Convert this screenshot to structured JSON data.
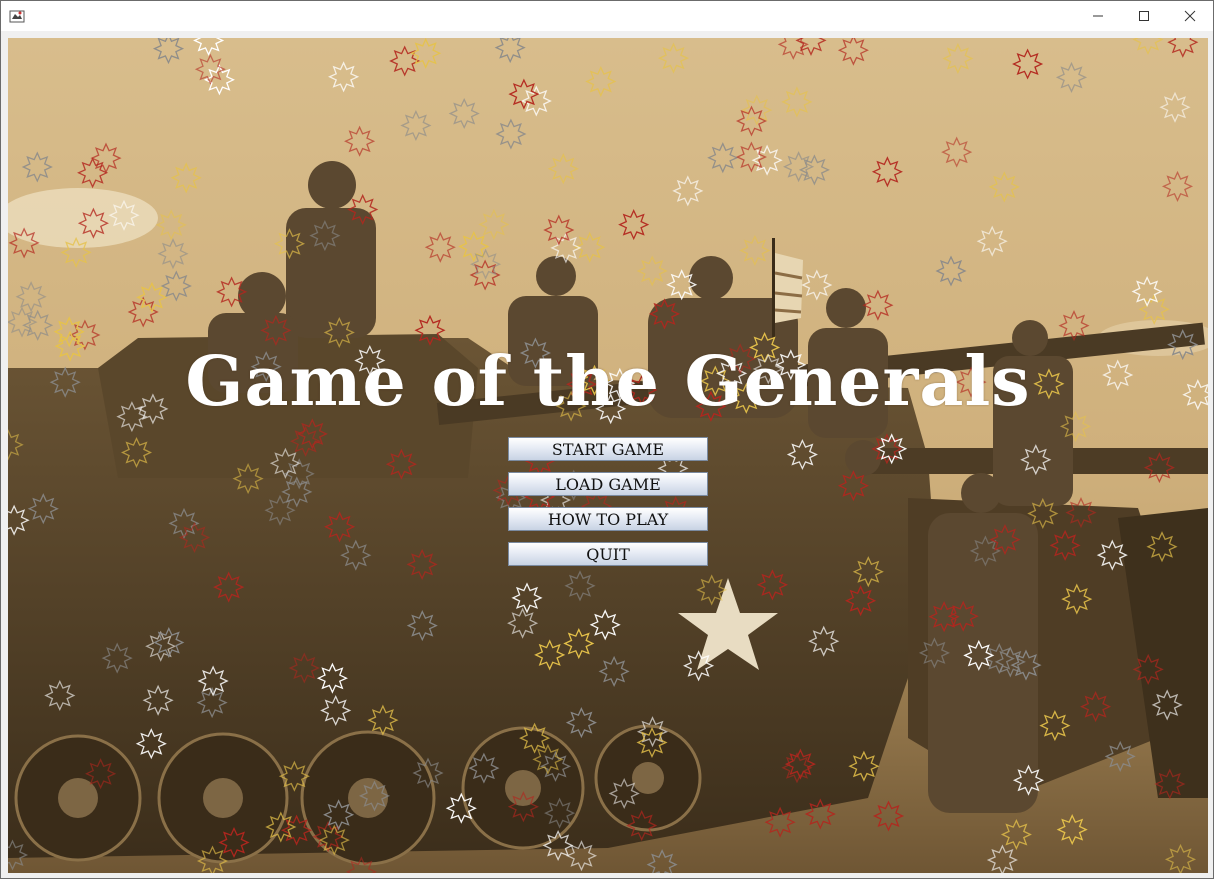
{
  "window": {
    "title": "",
    "controls": {
      "minimize": "–",
      "maximize": "☐",
      "close": "✕"
    }
  },
  "game": {
    "title": "Game of the Generals",
    "menu": [
      {
        "id": "start",
        "label": "START GAME"
      },
      {
        "id": "load",
        "label": "LOAD GAME"
      },
      {
        "id": "howto",
        "label": "HOW TO PLAY"
      },
      {
        "id": "quit",
        "label": "QUIT"
      }
    ]
  },
  "colors": {
    "sepia_sky": "#d9bf8e",
    "sepia_ground": "#8a6e45",
    "tank_dark": "#4a3a24",
    "star_red": "#b3261e",
    "star_yellow": "#e6c24a",
    "star_gray": "#8a8a8a",
    "title_text": "#ffffff"
  },
  "background": {
    "description_icons": [
      "tank-silhouette",
      "soldier-silhouette",
      "flag",
      "star-particles"
    ]
  }
}
